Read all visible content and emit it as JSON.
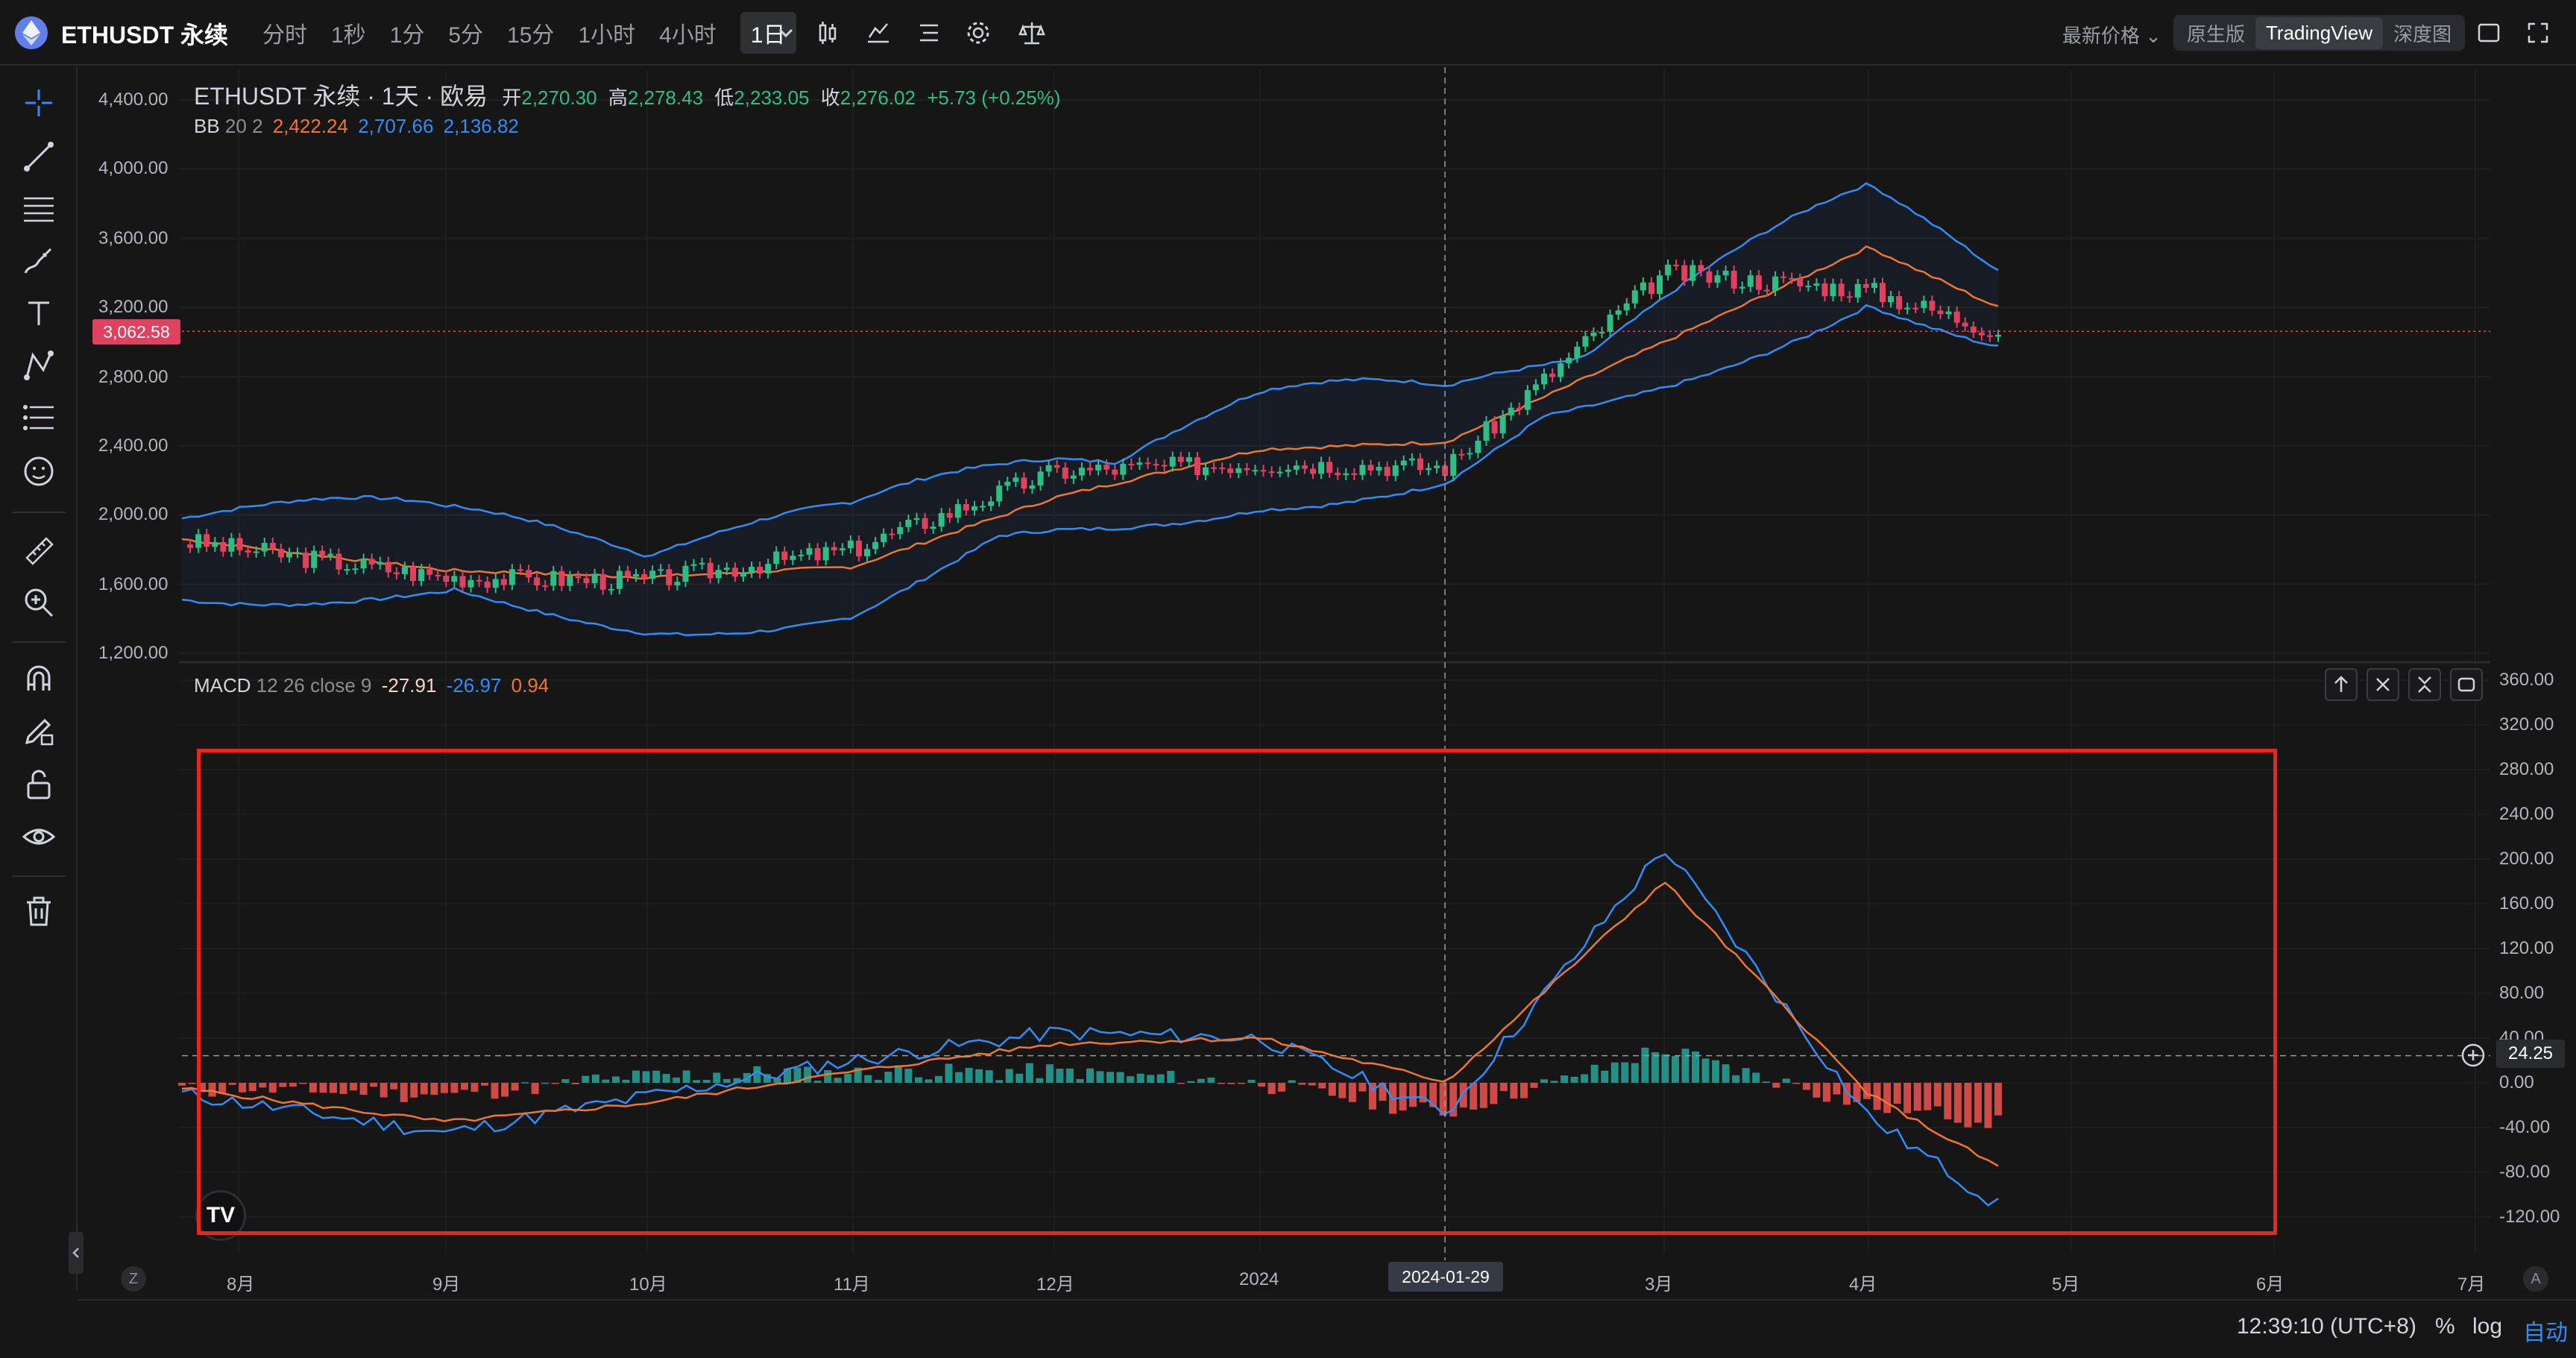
{
  "header": {
    "symbol": "ETHUSDT 永续",
    "intervals": [
      "分时",
      "1秒",
      "1分",
      "5分",
      "15分",
      "1小时",
      "4小时",
      "1日"
    ],
    "active_interval": "1日",
    "price_type": "最新价格",
    "views": [
      "原生版",
      "TradingView",
      "深度图"
    ],
    "active_view": "TradingView"
  },
  "legend": {
    "title": "ETHUSDT 永续 · 1天 · 欧易",
    "open_label": "开",
    "open": "2,270.30",
    "high_label": "高",
    "high": "2,278.43",
    "low_label": "低",
    "low": "2,233.05",
    "close_label": "收",
    "close": "2,276.02",
    "change": "+5.73 (+0.25%)",
    "bb_label": "BB",
    "bb_params": "20 2",
    "bb_mid": "2,422.24",
    "bb_upper": "2,707.66",
    "bb_lower": "2,136.82"
  },
  "macd_legend": {
    "label": "MACD",
    "params": "12 26 close 9",
    "hist": "-27.91",
    "macd": "-26.97",
    "signal": "0.94"
  },
  "price_axis": [
    "4,400.00",
    "4,000.00",
    "3,600.00",
    "3,200.00",
    "2,800.00",
    "2,400.00",
    "2,000.00",
    "1,600.00",
    "1,200.00"
  ],
  "macd_axis": [
    "360.00",
    "320.00",
    "280.00",
    "240.00",
    "200.00",
    "160.00",
    "120.00",
    "80.00",
    "40.00",
    "0.00",
    "-40.00",
    "-80.00",
    "-120.00"
  ],
  "current_price_tag": "3,062.58",
  "crosshair_value": "24.25",
  "time_axis": [
    "8月",
    "9月",
    "10月",
    "11月",
    "12月",
    "2024",
    "3月",
    "4月",
    "5月",
    "6月",
    "7月"
  ],
  "crosshair_date": "2024-01-29",
  "footer": {
    "clock": "12:39:10 (UTC+8)",
    "percent": "%",
    "log": "log",
    "auto": "自动",
    "zoom_left": "Z",
    "zoom_right": "A"
  },
  "logo_text": "TV",
  "colors": {
    "up": "#26a69a",
    "down": "#ef5350",
    "bb_mid": "#f0762b",
    "bb_band": "#2f8dfa",
    "accent_red": "#e8261e",
    "price_tag": "#e0415e"
  },
  "chart_data": [
    {
      "type": "line",
      "title": "ETHUSDT 永续 · 1天 · 欧易",
      "ylim": [
        1200,
        4400
      ],
      "x": [
        "8月",
        "9月",
        "10月",
        "11月",
        "12月",
        "2024",
        "2024-01-29",
        "3月",
        "4月"
      ],
      "series": [
        {
          "name": "close",
          "values": [
            1850,
            1640,
            1620,
            1800,
            2250,
            2300,
            2276,
            3400,
            3300
          ]
        },
        {
          "name": "BB",
          "values": [
            1860,
            1680,
            1640,
            1700,
            2100,
            2380,
            2422,
            3000,
            3550
          ]
        }
      ]
    },
    {
      "type": "line",
      "title": "MACD 12 26 close 9",
      "ylim": [
        -120,
        360
      ],
      "x": [
        "8月",
        "9月",
        "10月",
        "11月",
        "12月",
        "2024",
        "2024-01-29",
        "3月",
        "4月"
      ],
      "series": [
        {
          "name": "MACD",
          "values": [
            -10,
            -45,
            -12,
            20,
            45,
            40,
            -27,
            210,
            -30
          ]
        },
        {
          "name": "signal",
          "values": [
            -5,
            -35,
            -18,
            10,
            35,
            40,
            1,
            180,
            -10
          ]
        }
      ]
    }
  ]
}
